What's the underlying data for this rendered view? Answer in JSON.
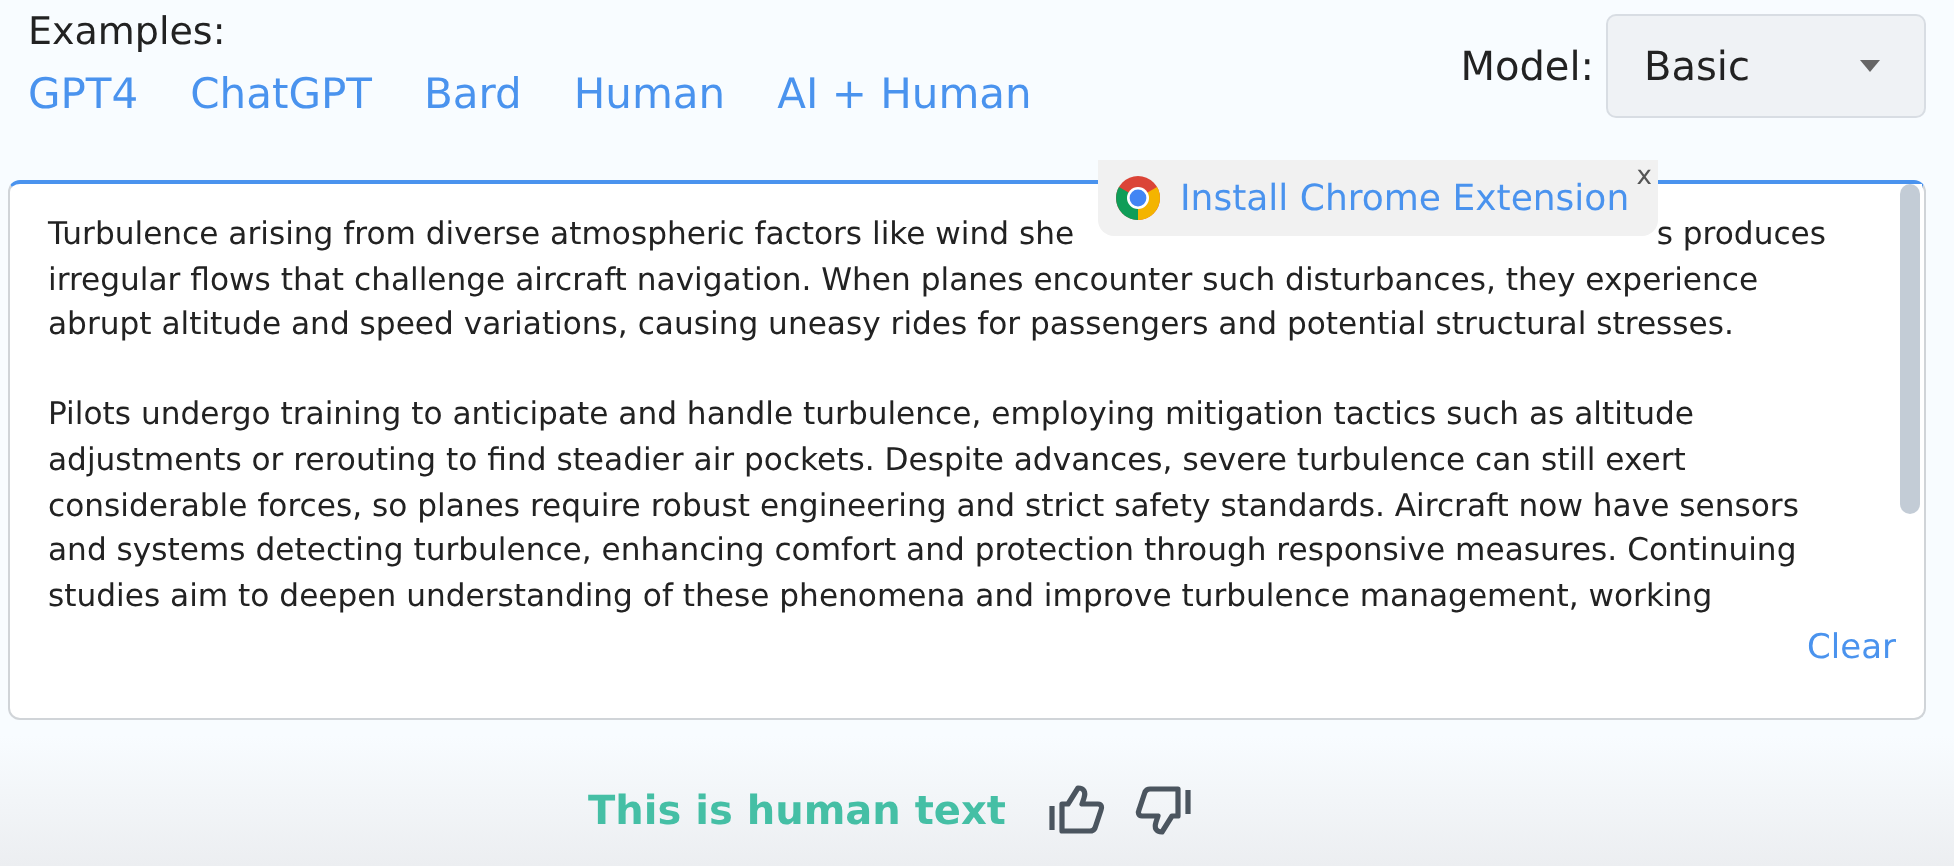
{
  "examples": {
    "label": "Examples:",
    "links": [
      "GPT4",
      "ChatGPT",
      "Bard",
      "Human",
      "AI + Human"
    ]
  },
  "model": {
    "label": "Model:",
    "value": "Basic"
  },
  "editor": {
    "first_line": [
      "Turbulence arising from diverse atmospheric factors like wind she",
      "s produces"
    ],
    "paragraphs": [
      [
        "irregular flows that challenge aircraft navigation. When planes encounter such disturbances, they experience",
        "abrupt altitude and speed variations, causing uneasy rides for passengers and potential structural stresses."
      ],
      [
        "Pilots undergo training to anticipate and handle turbulence, employing mitigation tactics such as altitude",
        "adjustments or rerouting to find steadier air pockets. Despite advances, severe turbulence can still exert",
        "considerable forces, so planes require robust engineering and strict safety standards. Aircraft now have sensors",
        "and systems detecting turbulence, enhancing comfort and protection through responsive measures. Continuing",
        "studies aim to deepen understanding of these phenomena and improve turbulence management, working"
      ]
    ],
    "clear": "Clear"
  },
  "popup": {
    "text": "Install Chrome Extension",
    "close": "x"
  },
  "verdict": {
    "text": "This is human text"
  }
}
